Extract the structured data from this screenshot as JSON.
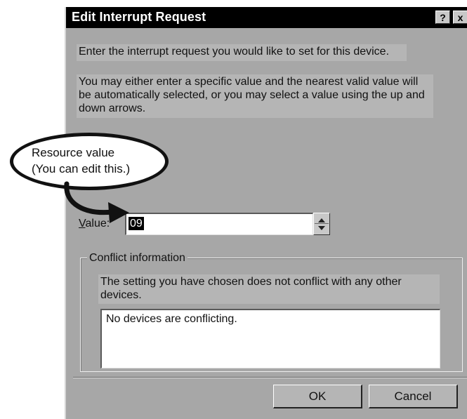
{
  "dialog": {
    "title": "Edit Interrupt Request",
    "help_symbol": "?",
    "close_symbol": "x",
    "intro": "Enter the interrupt request you would like to set for this device.",
    "instructions": "You may either enter a specific value and the nearest valid value will be automatically selected, or you may select a value using the up and down arrows.",
    "value_label_accel": "V",
    "value_label_rest": "alue:",
    "value": "09",
    "conflict_group_title": "Conflict information",
    "conflict_status": "The setting you have chosen does not conflict with any other devices.",
    "conflict_list": "No devices are conflicting.",
    "ok_label": "OK",
    "cancel_label": "Cancel"
  },
  "callout": {
    "line1": "Resource value",
    "line2": "(You can edit this.)"
  }
}
